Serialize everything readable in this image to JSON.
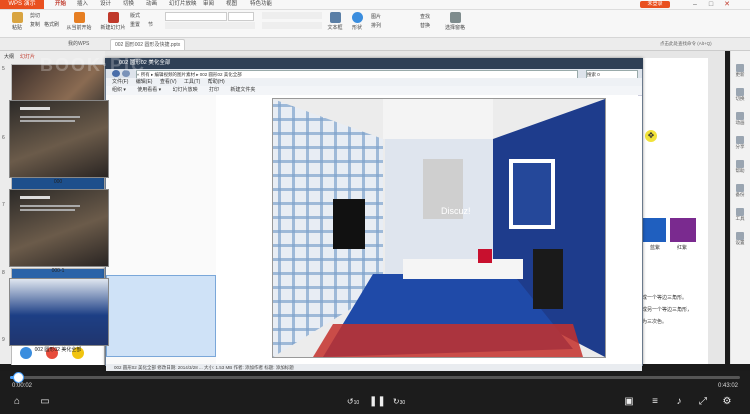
{
  "titlebar": {
    "app_name": "WPS 演示",
    "tabs": [
      "开始",
      "插入",
      "设计",
      "切换",
      "动画",
      "幻灯片放映",
      "审阅",
      "视图",
      "特色功能"
    ],
    "active_tab": "开始",
    "login_label": "未登录"
  },
  "ribbon": {
    "paste": "粘贴",
    "cut": "剪切",
    "copy": "复制",
    "format_painter": "格式刷",
    "from_start": "从当前开始",
    "new_slide": "新建幻灯片",
    "layout": "版式",
    "reset": "重置",
    "section": "节",
    "picture": "图片",
    "shape": "形状",
    "arrange": "排列",
    "textbox": "文本框",
    "find": "查找",
    "replace": "替换",
    "select_pane": "选择窗格"
  },
  "doctabs": {
    "tab1": "我的WPS",
    "tab2": "002 圆形002 圆形及快捷.pptx",
    "search_hint": "点击此处查找命令 (Alt+Q)"
  },
  "leftpanel": {
    "tabs": [
      "大纲",
      "幻灯片"
    ],
    "slides": [
      "5",
      "6",
      "7",
      "8",
      "9"
    ]
  },
  "explorer": {
    "title": "002 圆形02 美化全部",
    "address": "« 所有 ▸ 编辑视频的图片素材 ▸ 002 圆形02 美化全部",
    "search_label": "搜索 0",
    "menu": [
      "文件(F)",
      "编辑(E)",
      "查看(V)",
      "工具(T)",
      "帮助(H)"
    ],
    "toolbar": [
      "组织 ▾",
      "使用看看 ▾",
      "幻灯片放映",
      "打印",
      "新建文件夹"
    ],
    "files": [
      "000",
      "000-1",
      "002 圆形02 美化全部"
    ],
    "preview_watermark": "Discuz!",
    "status": "002 圆形02 美化全部 修改日期: 2014/3/28 ... 大小: 1.53 MB 作者: 添加作者 标题: 添加标题"
  },
  "slide_side": {
    "label_blue": "蓝紫",
    "label_red": "红紫",
    "text1": "成一个等边三角形。",
    "text2": "成另一个等边三角形，",
    "text3": "为三次色。"
  },
  "rightbar": {
    "items": [
      "更新",
      "切换",
      "动画",
      "分享",
      "帮助",
      "备份",
      "工具",
      "设置"
    ]
  },
  "player": {
    "time_current": "0:00:02",
    "time_total": "0:43:02",
    "progress": 0.01,
    "back_label": "10",
    "forward_label": "30",
    "watermark": "BOOK·PIC"
  }
}
